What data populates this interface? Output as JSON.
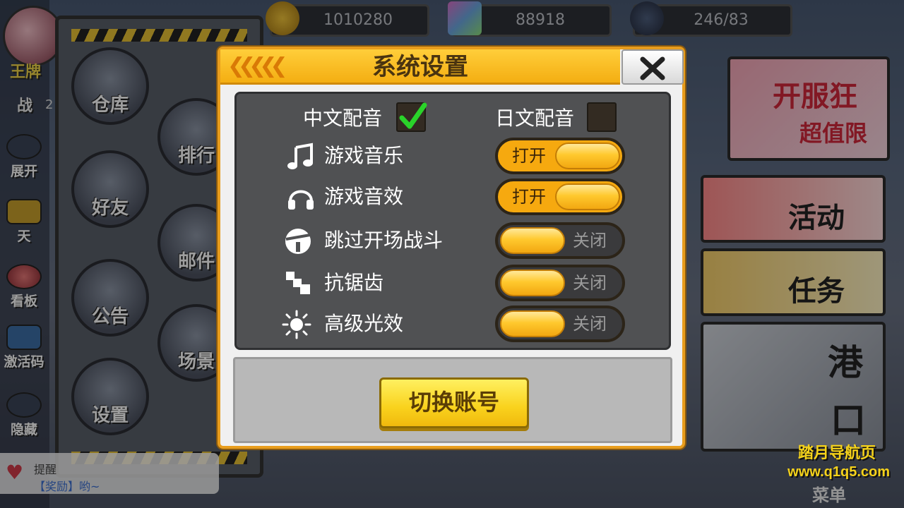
{
  "hud": {
    "player_name": "王牌",
    "power_label": "战",
    "power_value": "2",
    "resources": [
      {
        "name": "gold",
        "icon": "gold-coin-icon",
        "value": "1010280"
      },
      {
        "name": "gems",
        "icon": "gem-icon",
        "value": "88918"
      },
      {
        "name": "stamina",
        "icon": "lightning-icon",
        "value": "246/83"
      }
    ]
  },
  "left_rail": {
    "items": [
      {
        "label": "展开",
        "icon": "play-icon"
      },
      {
        "label": "天",
        "icon": "chat-icon"
      },
      {
        "label": "看板",
        "icon": "flower-icon"
      },
      {
        "label": "激活码",
        "icon": "code-card-icon"
      },
      {
        "label": "隐藏",
        "icon": "eye-icon"
      }
    ]
  },
  "side_menu": {
    "items": [
      {
        "label": "仓库",
        "icon": "warehouse-icon"
      },
      {
        "label": "排行",
        "icon": "podium-icon"
      },
      {
        "label": "好友",
        "icon": "friend-icon"
      },
      {
        "label": "邮件",
        "icon": "mail-icon"
      },
      {
        "label": "公告",
        "icon": "megaphone-icon"
      },
      {
        "label": "场景",
        "icon": "scene-icon"
      },
      {
        "label": "设置",
        "icon": "gear-icon"
      }
    ]
  },
  "right_panel": {
    "banner_text": "开服狂",
    "banner_sub": "超值限",
    "activity_label": "活动",
    "task_label": "任务",
    "port_label_1": "港",
    "port_label_2": "口",
    "menu_label": "菜单"
  },
  "feed": {
    "line1": "提醒",
    "line2": "【奖励】哟~"
  },
  "dialog": {
    "title": "系统设置",
    "close_icon": "close-icon",
    "voice": {
      "chinese_label": "中文配音",
      "chinese_checked": true,
      "japanese_label": "日文配音",
      "japanese_checked": false
    },
    "settings": [
      {
        "key": "music",
        "label": "游戏音乐",
        "icon": "music-note-icon",
        "state": "on",
        "state_label": "打开"
      },
      {
        "key": "sfx",
        "label": "游戏音效",
        "icon": "headphones-icon",
        "state": "on",
        "state_label": "打开"
      },
      {
        "key": "skip_battle",
        "label": "跳过开场战斗",
        "icon": "skip-battle-icon",
        "state": "off",
        "state_label": "关闭"
      },
      {
        "key": "antialias",
        "label": "抗锯齿",
        "icon": "antialias-icon",
        "state": "off",
        "state_label": "关闭"
      },
      {
        "key": "light_fx",
        "label": "高级光效",
        "icon": "sun-icon",
        "state": "off",
        "state_label": "关闭"
      }
    ],
    "switch_account_label": "切换账号"
  },
  "watermark": {
    "site_name": "踏月导航页",
    "url": "www.q1q5.com"
  },
  "colors": {
    "accent_orange": "#f4ae12",
    "toggle_on": "#f6a90f",
    "toggle_off": "#3a3a3c",
    "panel_dark": "#505153",
    "button_yellow": "#f9d21d",
    "watermark_yellow": "#f5d21a"
  }
}
